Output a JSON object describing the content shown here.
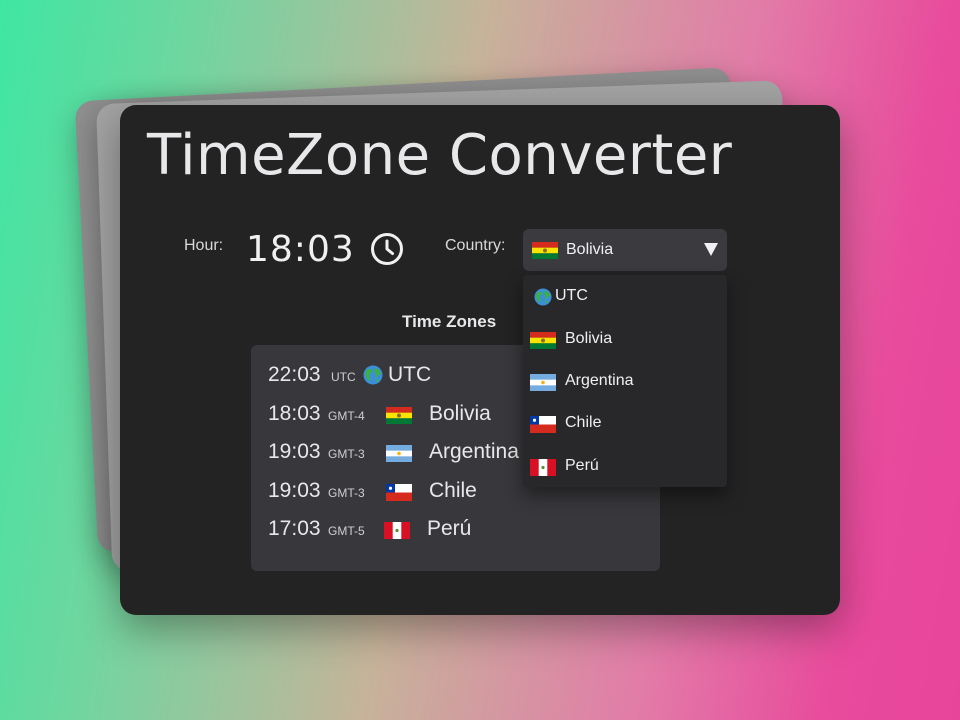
{
  "app": {
    "title": "TimeZone Converter"
  },
  "controls": {
    "hour_label": "Hour:",
    "hour_value": "18:03",
    "clock_icon": "clock-icon",
    "country_label": "Country:",
    "selected_country": "Bolivia",
    "selected_flag": "flag-bolivia"
  },
  "dropdown": {
    "options": [
      {
        "label": "UTC",
        "icon": "globe-icon"
      },
      {
        "label": "Bolivia",
        "icon": "flag-bolivia"
      },
      {
        "label": "Argentina",
        "icon": "flag-argentina"
      },
      {
        "label": "Chile",
        "icon": "flag-chile"
      },
      {
        "label": "Perú",
        "icon": "flag-peru"
      }
    ]
  },
  "zones": {
    "heading": "Time Zones",
    "rows": [
      {
        "time": "22:03",
        "offset": "UTC",
        "icon": "globe-icon",
        "name": "UTC"
      },
      {
        "time": "18:03",
        "offset": "GMT-4",
        "icon": "flag-bolivia",
        "name": "Bolivia"
      },
      {
        "time": "19:03",
        "offset": "GMT-3",
        "icon": "flag-argentina",
        "name": "Argentina"
      },
      {
        "time": "19:03",
        "offset": "GMT-3",
        "icon": "flag-chile",
        "name": "Chile"
      },
      {
        "time": "17:03",
        "offset": "GMT-5",
        "icon": "flag-peru",
        "name": "Perú"
      }
    ]
  },
  "colors": {
    "card_background": "#232324",
    "panel_background": "#38383c",
    "select_background": "#3b3b3f",
    "dropdown_background": "#28282b",
    "text": "#e8e8ea",
    "gradient_left": "#3fe6a2",
    "gradient_right": "#e8459a"
  }
}
